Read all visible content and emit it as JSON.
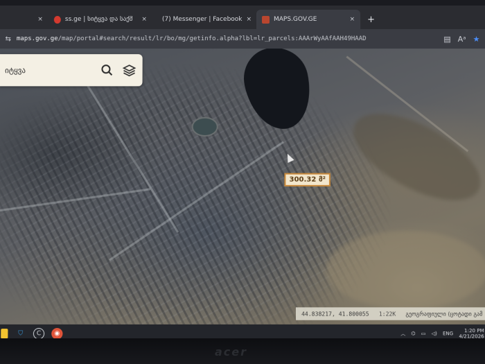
{
  "browser": {
    "tabs": [
      {
        "label": "",
        "favicon": "blank-icon",
        "active": false
      },
      {
        "label": "ss.ge | სიტყვა და საქმე ერ",
        "favicon": "ssge-icon",
        "active": false
      },
      {
        "label": "(7) Messenger | Facebook",
        "favicon": "facebook-icon",
        "active": false
      },
      {
        "label": "MAPS.GOV.GE",
        "favicon": "mapsgov-icon",
        "active": true
      }
    ],
    "close_glyph": "×",
    "new_tab_glyph": "+",
    "address": {
      "host": "maps.gov.ge",
      "path": "/map/portal#search/result/lr/bo/mg/getinfo.alpha?lbl=lr_parcels:AAArWyAAfAAH49HAAD"
    }
  },
  "search_panel": {
    "text": "იტყვა",
    "icons": [
      "search-icon",
      "layers-icon"
    ]
  },
  "map": {
    "measurement_label": "300.32 მ²",
    "coordinates": "44.838217, 41.800055",
    "scale": "1:22K",
    "attribution": "გეოგრაფიული (ცოტადი გამ"
  },
  "taskbar": {
    "left_icons": [
      "windows-start-icon",
      "security-shield-icon",
      "c-app-icon",
      "browser-icon"
    ],
    "tray_icons": [
      "chevron-up-icon",
      "network-icon",
      "battery-icon",
      "speaker-icon"
    ],
    "language": "ENG",
    "time": "1:20 PM",
    "date": "4/21/2026"
  },
  "colors": {
    "measure_border": "#c8893b",
    "search_bg": "#f4f0e4",
    "tab_active": "#3a3c43"
  },
  "device_brand": "acer"
}
